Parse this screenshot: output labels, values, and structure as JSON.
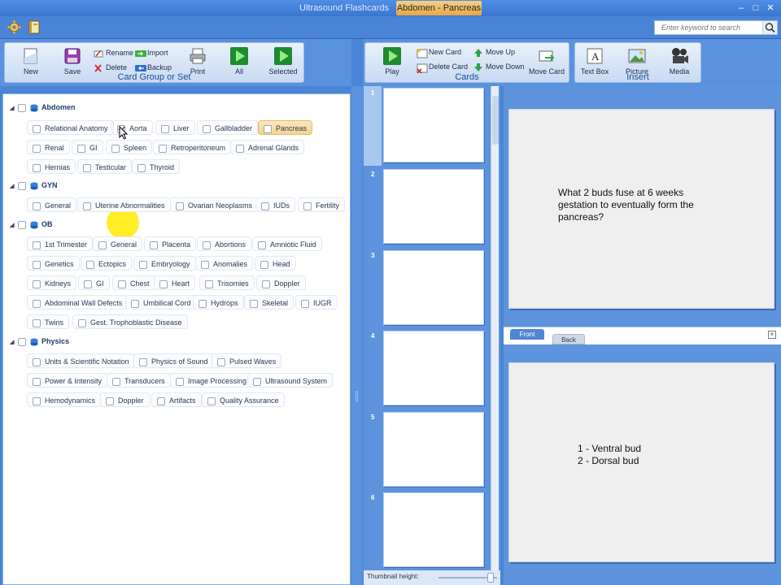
{
  "window": {
    "app_title": "Ultrasound Flashcards",
    "active_tab": "Abdomen - Pancreas",
    "controls": [
      "–",
      "□",
      "✕"
    ]
  },
  "quickbar": {
    "search_placeholder": "Enter keyword to search"
  },
  "ribbon": {
    "card_group": {
      "label": "Card Group or Set",
      "new": "New",
      "save": "Save",
      "rename": "Rename",
      "delete": "Delete",
      "import": "Import",
      "backup": "Backup",
      "print": "Print",
      "all": "All",
      "selected": "Selected"
    },
    "cards": {
      "label": "Cards",
      "play": "Play",
      "new_card": "New Card",
      "delete_card": "Delete Card",
      "move_up": "Move Up",
      "move_down": "Move Down",
      "move_card": "Move Card"
    },
    "insert": {
      "label": "Insert",
      "text_box": "Text Box",
      "picture": "Picture",
      "media": "Media"
    }
  },
  "tree": {
    "abdomen": {
      "label": "Abdomen",
      "items": [
        "Relational Anatomy",
        "Aorta",
        "Liver",
        "Gallbladder",
        "Pancreas",
        "Renal",
        "GI",
        "Spleen",
        "Retroperitoneum",
        "Adrenal Glands",
        "Hernias",
        "Testicular",
        "Thyroid"
      ]
    },
    "gyn": {
      "label": "GYN",
      "items": [
        "General",
        "Uterine Abnormalities",
        "Ovarian Neoplasms",
        "IUDs",
        "Fertility"
      ]
    },
    "ob": {
      "label": "OB",
      "items": [
        "1st Trimester",
        "General",
        "Placenta",
        "Abortions",
        "Amniotic Fluid",
        "Genetics",
        "Ectopics",
        "Embryology",
        "Anomalies",
        "Head",
        "Kidneys",
        "GI",
        "Chest",
        "Heart",
        "Trisomies",
        "Doppler",
        "Abdominal Wall Defects",
        "Umbilical Cord",
        "Hydrops",
        "Skeletal",
        "IUGR",
        "Twins",
        "Gest. Trophoblastic Disease"
      ]
    },
    "physics": {
      "label": "Physics",
      "items": [
        "Units & Scientific Notation",
        "Physics of Sound",
        "Pulsed Waves",
        "Power & Intensity",
        "Transducers",
        "Image Processing",
        "Ultrasound System",
        "Hemodynamics",
        "Doppler",
        "Artifacts",
        "Quality Assurance"
      ]
    }
  },
  "thumbnails": {
    "numbers": [
      "1",
      "2",
      "3",
      "4",
      "5",
      "6"
    ],
    "texts": [
      "",
      "",
      "",
      "",
      "",
      ""
    ],
    "height_label": "Thumbnail height:"
  },
  "editor": {
    "front_text": "What 2 buds fuse at 6 weeks\ngestation to eventually form the\npancreas?",
    "back_text": "1 - Ventral bud\n2 - Dorsal bud",
    "tab_front": "Front",
    "tab_back": "Back"
  },
  "colors": {
    "chrome": "#4a84d6",
    "accent": "#f2d38f",
    "group_title": "#1c4f9a"
  }
}
